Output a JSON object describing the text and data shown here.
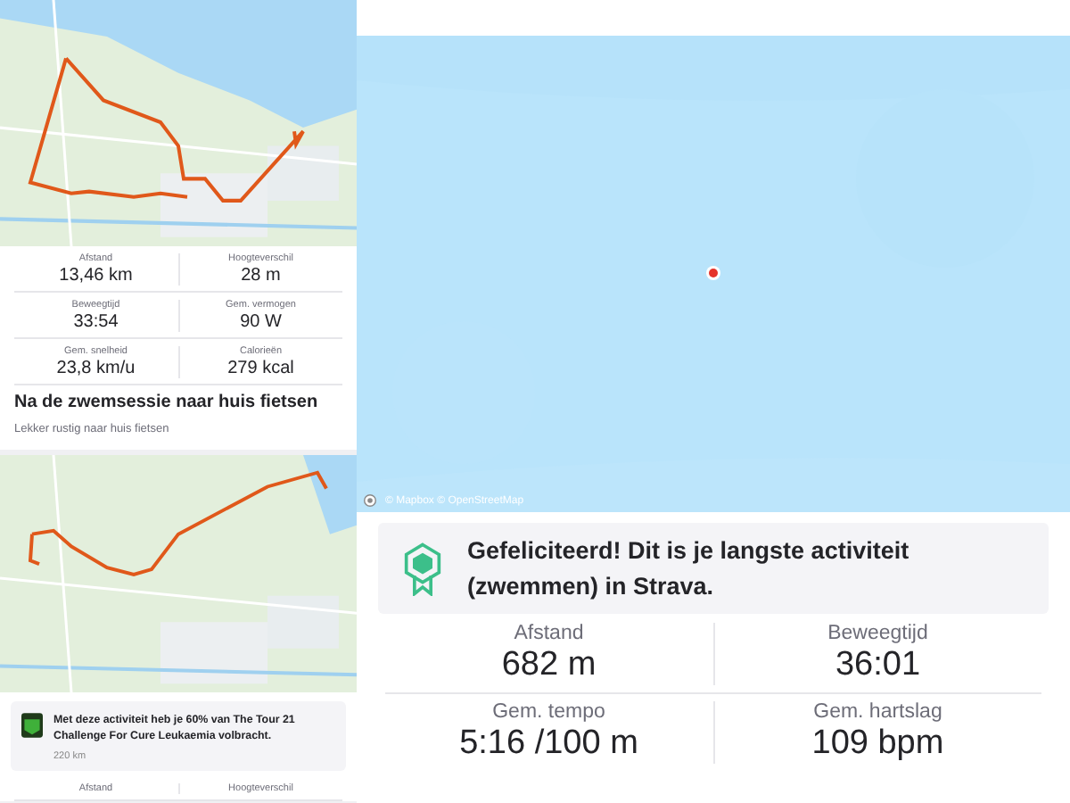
{
  "feed": [
    {
      "stats": [
        {
          "label": "Afstand",
          "value": "13,46 km"
        },
        {
          "label": "Hoogteverschil",
          "value": "28 m"
        },
        {
          "label": "Beweegtijd",
          "value": "33:54"
        },
        {
          "label": "Gem. vermogen",
          "value": "90 W"
        },
        {
          "label": "Gem. snelheid",
          "value": "23,8 km/u"
        },
        {
          "label": "Calorieën",
          "value": "279 kcal"
        }
      ],
      "title": "Na de zwemsessie naar huis fietsen",
      "description": "Lekker rustig naar huis fietsen"
    },
    {
      "achievement": {
        "text": "Met deze activiteit heb je 60% van The Tour 21 Challenge For Cure Leukaemia volbracht.",
        "detail": "220 km"
      },
      "stats": [
        {
          "label": "Afstand"
        },
        {
          "label": "Hoogteverschil"
        }
      ]
    }
  ],
  "detail": {
    "map_attribution": "© Mapbox © OpenStreetMap",
    "achievement": {
      "text": "Gefeliciteerd! Dit is je langste activiteit (zwemmen) in Strava."
    },
    "stats": [
      {
        "label": "Afstand",
        "value": "682 m"
      },
      {
        "label": "Beweegtijd",
        "value": "36:01"
      },
      {
        "label": "Gem. tempo",
        "value": "5:16 /100 m"
      },
      {
        "label": "Gem. hartslag",
        "value": "109 bpm"
      }
    ]
  }
}
